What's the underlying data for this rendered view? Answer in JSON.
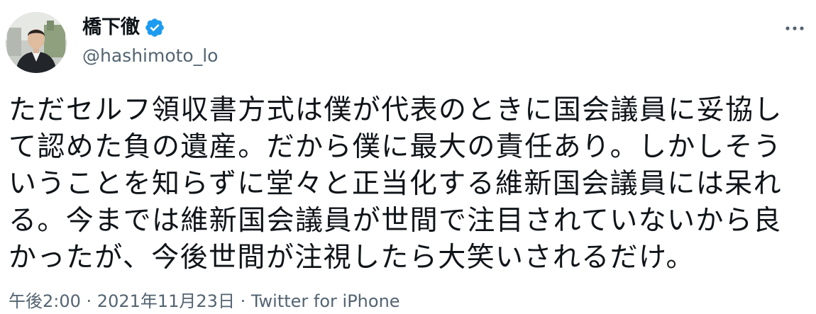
{
  "author": {
    "display_name": "橋下徹",
    "handle": "@hashimoto_lo",
    "verified": true,
    "verified_color": "#1d9bf0"
  },
  "tweet": {
    "lines": [
      "ただセルフ領収書方式は僕が代表のときに国会議員に妥協し",
      "て認めた負の遺産。だから僕に最大の責任あり。しかしそう",
      "いうことを知らずに堂々と正当化する維新国会議員には呆れ",
      "る。今までは維新国会議員が世間で注目されていないから良",
      "かったが、今後世間が注視したら大笑いされるだけ。"
    ]
  },
  "meta": {
    "time": "午後2:00",
    "separator": " · ",
    "date": "2021年11月23日",
    "source": "Twitter for iPhone"
  },
  "icons": {
    "more": "more-horizontal-icon",
    "verified": "verified-badge-icon"
  },
  "colors": {
    "text": "#0f1419",
    "secondary": "#536471"
  }
}
